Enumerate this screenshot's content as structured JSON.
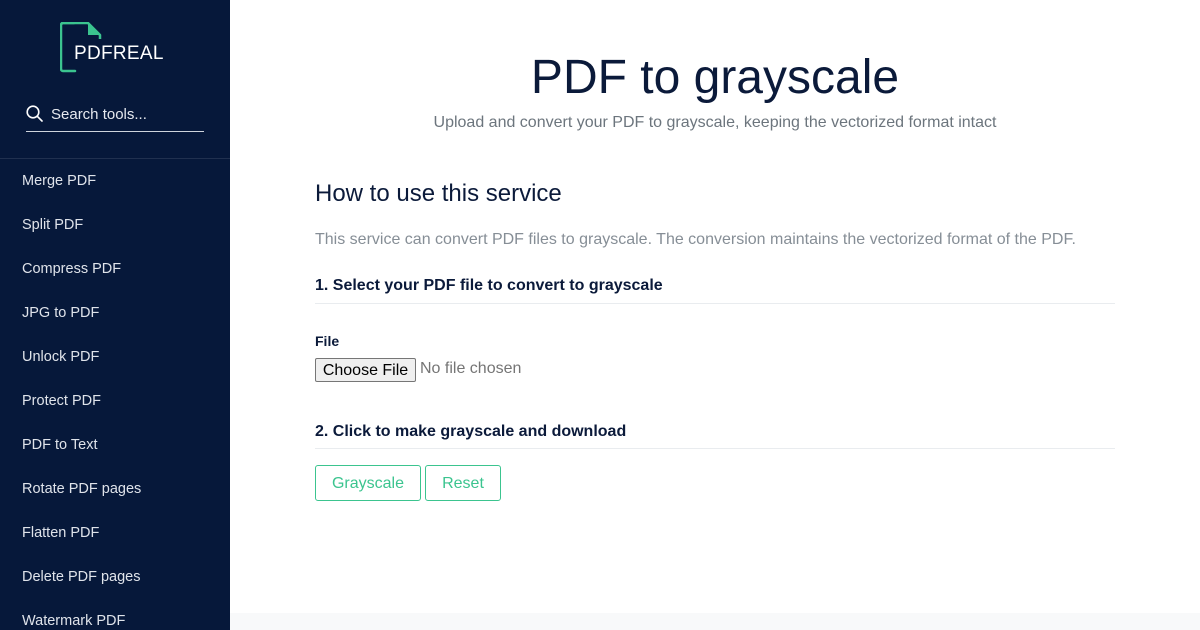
{
  "brand": {
    "name": "PDFREAL",
    "accent_color": "#3bc48f",
    "sidebar_color": "#06183a"
  },
  "search": {
    "placeholder": "Search tools..."
  },
  "sidebar": {
    "items": [
      {
        "label": "Merge PDF"
      },
      {
        "label": "Split PDF"
      },
      {
        "label": "Compress PDF"
      },
      {
        "label": "JPG to PDF"
      },
      {
        "label": "Unlock PDF"
      },
      {
        "label": "Protect PDF"
      },
      {
        "label": "PDF to Text"
      },
      {
        "label": "Rotate PDF pages"
      },
      {
        "label": "Flatten PDF"
      },
      {
        "label": "Delete PDF pages"
      },
      {
        "label": "Watermark PDF"
      }
    ]
  },
  "main": {
    "title": "PDF to grayscale",
    "subtitle": "Upload and convert your PDF to grayscale, keeping the vectorized format intact",
    "howto_heading": "How to use this service",
    "description": "This service can convert PDF files to grayscale. The conversion maintains the vectorized format of the PDF.",
    "step1_heading": "1. Select your PDF file to convert to grayscale",
    "file_label": "File",
    "choose_file_label": "Choose File",
    "no_file_text": "No file chosen",
    "step2_heading": "2. Click to make grayscale and download",
    "grayscale_button": "Grayscale",
    "reset_button": "Reset"
  }
}
